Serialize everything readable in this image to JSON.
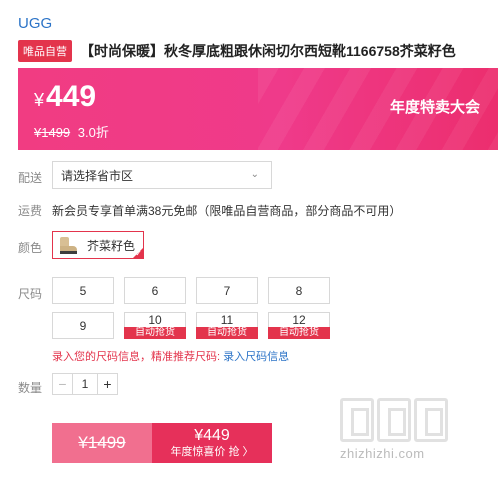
{
  "brand": "UGG",
  "product": {
    "badge": "唯品自营",
    "title": "【时尚保暖】秋冬厚底粗跟休闲切尔西短靴1166758芥菜籽色"
  },
  "price": {
    "symbol": "¥",
    "current": "449",
    "original": "¥1499",
    "discount": "3.0折",
    "promo_label": "年度特卖大会"
  },
  "delivery": {
    "label": "配送",
    "placeholder": "请选择省市区"
  },
  "shipping": {
    "label": "运费",
    "text": "新会员专享首单满38元免邮（限唯品自营商品，部分商品不可用）"
  },
  "color": {
    "label": "颜色",
    "selected": "芥菜籽色",
    "icon": "boot-thumbnail-icon"
  },
  "size": {
    "label": "尺码",
    "options": [
      {
        "value": "5",
        "tag": ""
      },
      {
        "value": "6",
        "tag": ""
      },
      {
        "value": "7",
        "tag": ""
      },
      {
        "value": "8",
        "tag": ""
      },
      {
        "value": "9",
        "tag": ""
      },
      {
        "value": "10",
        "tag": "自动抢货"
      },
      {
        "value": "11",
        "tag": "自动抢货"
      },
      {
        "value": "12",
        "tag": "自动抢货"
      }
    ],
    "hint_text": "录入您的尺码信息，精准推荐尺码:",
    "hint_link": "录入尺码信息"
  },
  "quantity": {
    "label": "数量",
    "value": "1",
    "minus": "−",
    "plus": "+"
  },
  "buy": {
    "original": "¥1499",
    "price": "¥449",
    "cta": "年度惊喜价 抢 〉"
  },
  "watermark": {
    "text": "zhizhizhi.com"
  },
  "colors": {
    "accent": "#e3344c",
    "banner": "#f13c82",
    "link": "#2b73c7"
  }
}
